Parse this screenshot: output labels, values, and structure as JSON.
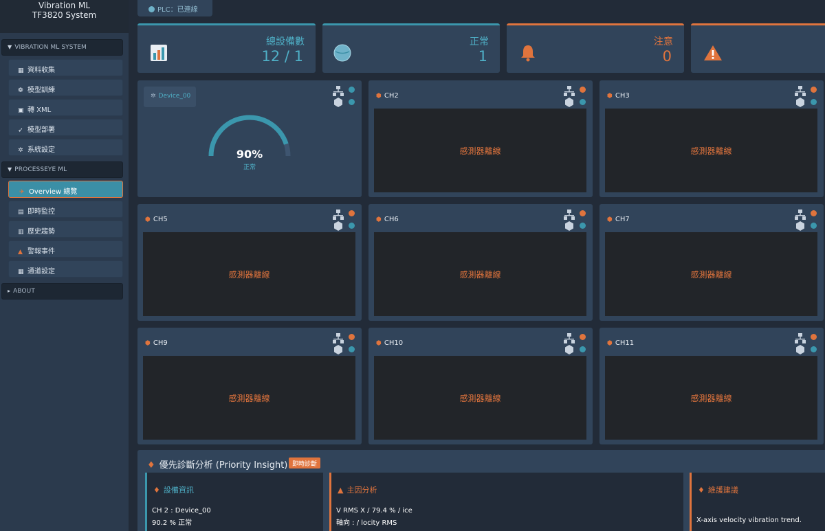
{
  "sidebar": {
    "brand_line1": "Vibration ML",
    "brand_line2": "TF3820 System",
    "sections": [
      {
        "label": "VIBRATION ML SYSTEM"
      },
      {
        "label": "PROCESSEYE ML"
      },
      {
        "label": "ABOUT"
      }
    ],
    "items": [
      {
        "label": "資料收集",
        "icon": "chart-icon"
      },
      {
        "label": "模型訓練",
        "icon": "brain-icon"
      },
      {
        "label": "轉 XML",
        "icon": "file-icon"
      },
      {
        "label": "模型部署",
        "icon": "rocket-icon"
      },
      {
        "label": "系統設定",
        "icon": "gear-icon"
      },
      {
        "label": "Overview 總覽",
        "icon": "plane-icon"
      },
      {
        "label": "即時監控",
        "icon": "line-chart-icon"
      },
      {
        "label": "歷史趨勢",
        "icon": "history-icon"
      },
      {
        "label": "警報事件",
        "icon": "warning-icon"
      },
      {
        "label": "通道設定",
        "icon": "grid-icon"
      }
    ]
  },
  "plc_status": "PLC：已連線",
  "stats": [
    {
      "label": "總設備數",
      "value": "12 / 1",
      "icon": "bar-chart-icon"
    },
    {
      "label": "正常",
      "value": "1",
      "icon": "globe-icon"
    },
    {
      "label": "注意",
      "value": "0",
      "icon": "bell-icon"
    },
    {
      "label": "",
      "value": "",
      "icon": "warning-triangle-icon"
    }
  ],
  "device_card": {
    "badge": "Device_00",
    "gauge_value": 0.9,
    "gauge_text": "90%",
    "gauge_label": "正常"
  },
  "channels": [
    {
      "name": "CH2",
      "status": "感測器離線"
    },
    {
      "name": "CH3",
      "status": "感測器離線"
    },
    {
      "name": "CH5",
      "status": "感測器離線"
    },
    {
      "name": "CH6",
      "status": "感測器離線"
    },
    {
      "name": "CH7",
      "status": "感測器離線"
    },
    {
      "name": "CH9",
      "status": "感測器離線"
    },
    {
      "name": "CH10",
      "status": "感測器離線"
    },
    {
      "name": "CH11",
      "status": "感測器離線"
    }
  ],
  "insight": {
    "title": "優先診斷分析 (Priority Insight)",
    "badge": "即時診斷",
    "panels": [
      {
        "header": "設備資訊",
        "line1": "CH 2 : Device_00",
        "line2": "90.2 %  正常"
      },
      {
        "header": "主因分析",
        "line1": "V RMS X / 79.4 % / ice",
        "line2": "軸向 : / locity RMS"
      },
      {
        "header": "維護建議",
        "line1": "",
        "line2": "X-axis velocity vibration trend."
      }
    ]
  },
  "colors": {
    "accent": "#3b97ad",
    "warn": "#e0743d",
    "panel": "#31445a",
    "bg": "#222b38"
  }
}
